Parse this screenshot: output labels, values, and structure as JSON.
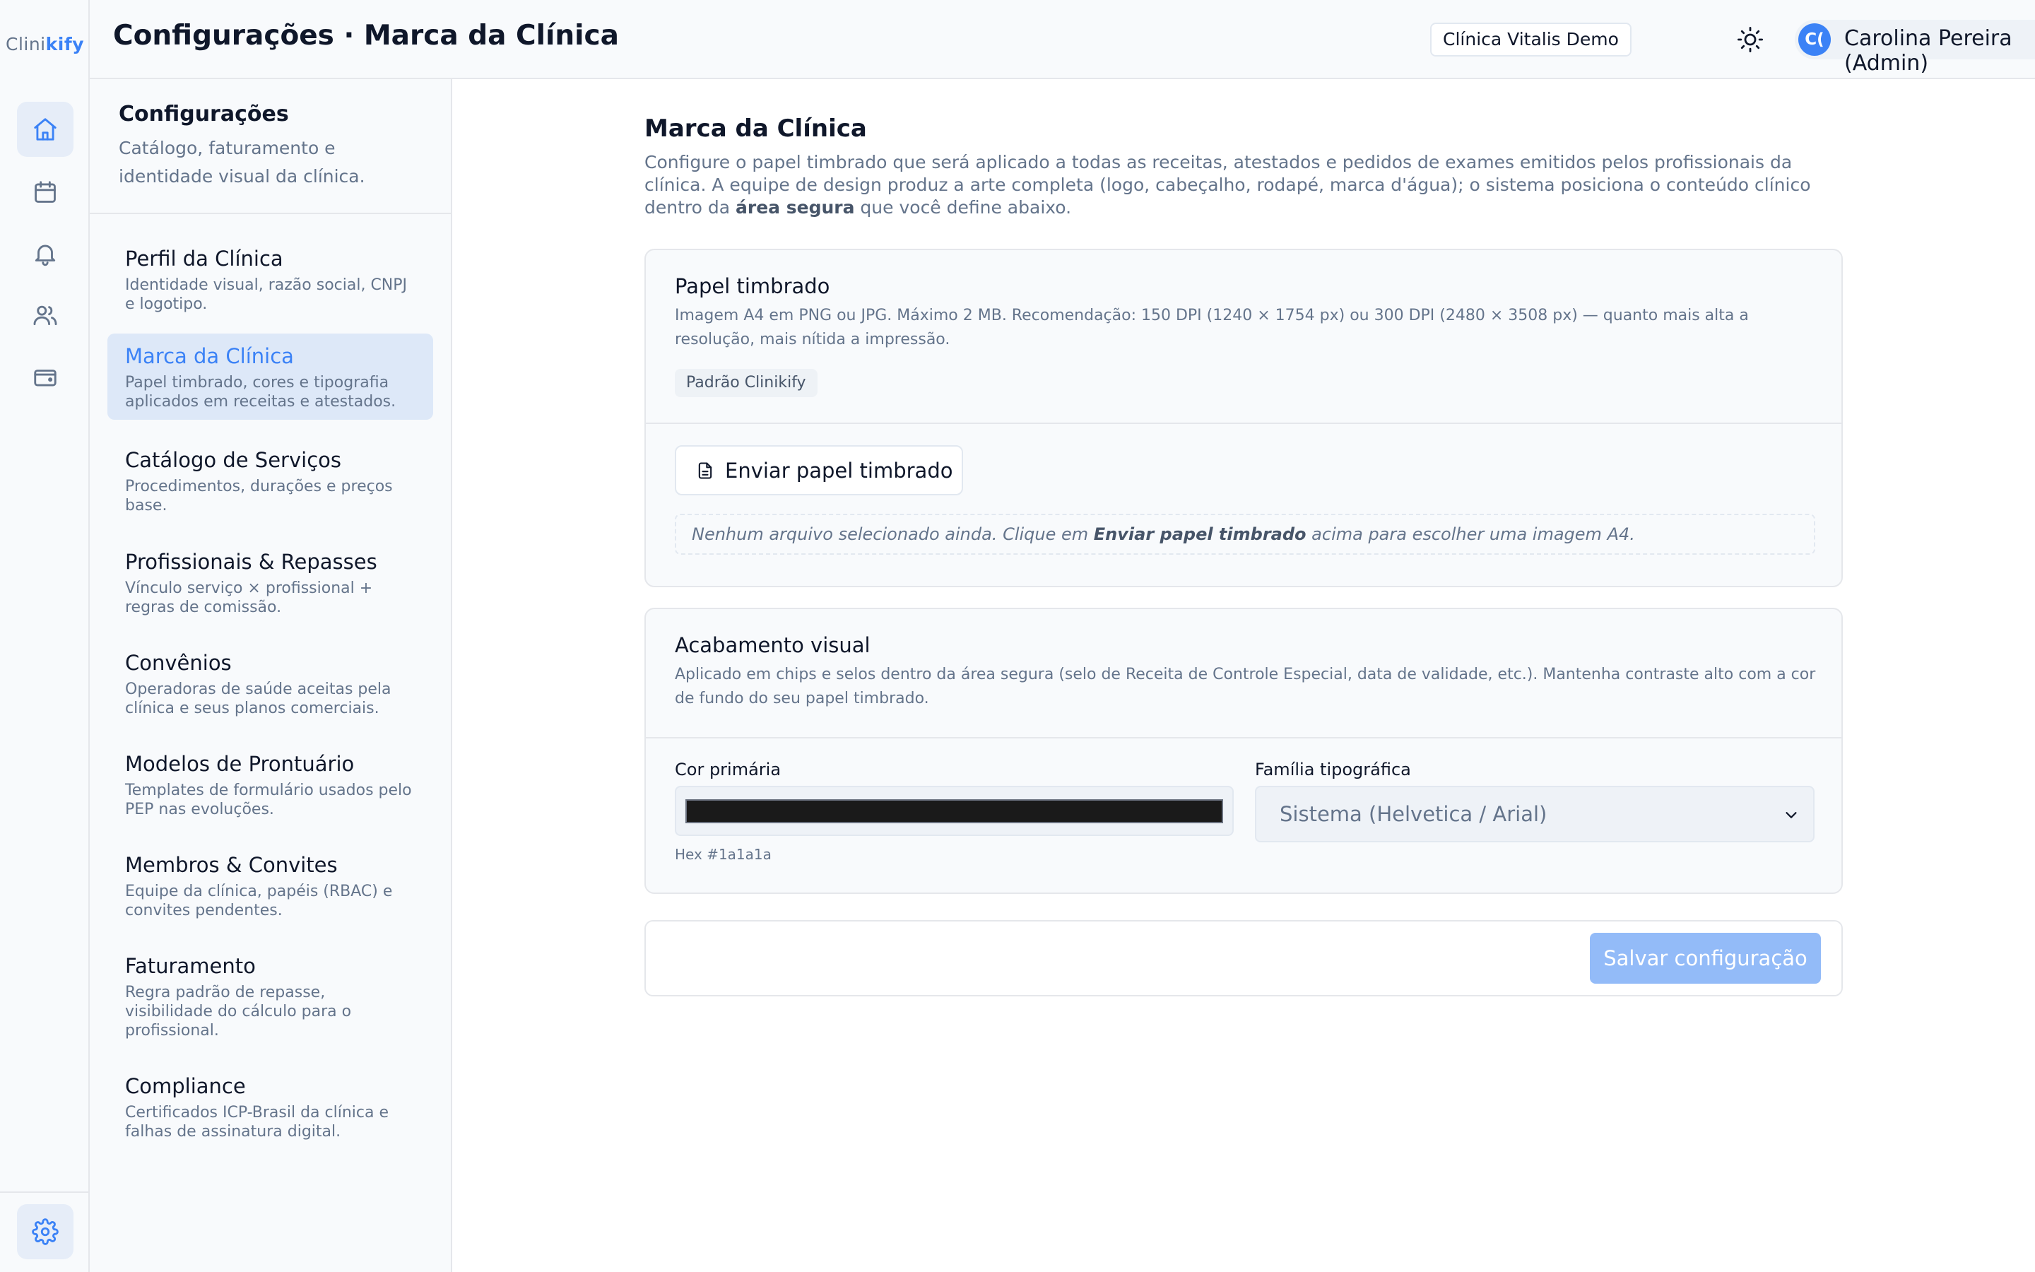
{
  "app": {
    "logo_prefix": "Clini",
    "logo_accent": "kify",
    "accent_color": "#3b82f6"
  },
  "rail": {
    "icons": [
      "home-icon",
      "calendar-icon",
      "bell-icon",
      "users-icon",
      "wallet-icon",
      "gear-icon"
    ]
  },
  "header": {
    "title": "Configurações · Marca da Clínica",
    "clinic": "Clínica Vitalis Demo",
    "user_initials": "C(",
    "user_name": "Carolina Pereira (Admin)"
  },
  "nav": {
    "title": "Configurações",
    "description": "Catálogo, faturamento e identidade visual da clínica.",
    "items": [
      {
        "label": "Perfil da Clínica",
        "desc": "Identidade visual, razão social, CNPJ e logotipo."
      },
      {
        "label": "Marca da Clínica",
        "desc": "Papel timbrado, cores e tipografia aplicados em receitas e atestados."
      },
      {
        "label": "Catálogo de Serviços",
        "desc": "Procedimentos, durações e preços base."
      },
      {
        "label": "Profissionais & Repasses",
        "desc": "Vínculo serviço × profissional + regras de comissão."
      },
      {
        "label": "Convênios",
        "desc": "Operadoras de saúde aceitas pela clínica e seus planos comerciais."
      },
      {
        "label": "Modelos de Prontuário",
        "desc": "Templates de formulário usados pelo PEP nas evoluções."
      },
      {
        "label": "Membros & Convites",
        "desc": "Equipe da clínica, papéis (RBAC) e convites pendentes."
      },
      {
        "label": "Faturamento",
        "desc": "Regra padrão de repasse, visibilidade do cálculo para o profissional."
      },
      {
        "label": "Compliance",
        "desc": "Certificados ICP-Brasil da clínica e falhas de assinatura digital."
      }
    ],
    "active_index": 1
  },
  "main": {
    "title": "Marca da Clínica",
    "desc_before": "Configure o papel timbrado que será aplicado a todas as receitas, atestados e pedidos de exames emitidos pelos profissionais da clínica. A equipe de design produz a arte completa (logo, cabeçalho, rodapé, marca d'água); o sistema posiciona o conteúdo clínico dentro da ",
    "desc_bold": "área segura",
    "desc_after": " que você define abaixo.",
    "letterhead": {
      "title": "Papel timbrado",
      "desc": "Imagem A4 em PNG ou JPG. Máximo 2 MB. Recomendação: 150 DPI (1240 × 1754 px) ou 300 DPI (2480 × 3508 px) — quanto mais alta a resolução, mais nítida a impressão.",
      "tag": "Padrão Clinikify",
      "upload_label": "Enviar papel timbrado",
      "empty_before": "Nenhum arquivo selecionado ainda. Clique em ",
      "empty_bold": "Enviar papel timbrado",
      "empty_after": " acima para escolher uma imagem A4."
    },
    "finish": {
      "title": "Acabamento visual",
      "desc": "Aplicado em chips e selos dentro da área segura (selo de Receita de Controle Especial, data de validade, etc.). Mantenha contraste alto com a cor de fundo do seu papel timbrado.",
      "color_label": "Cor primária",
      "color_value": "#1a1a1a",
      "hex_note": "Hex #1a1a1a",
      "font_label": "Família tipográfica",
      "font_value": "Sistema (Helvetica / Arial)"
    },
    "save_label": "Salvar configuração"
  }
}
